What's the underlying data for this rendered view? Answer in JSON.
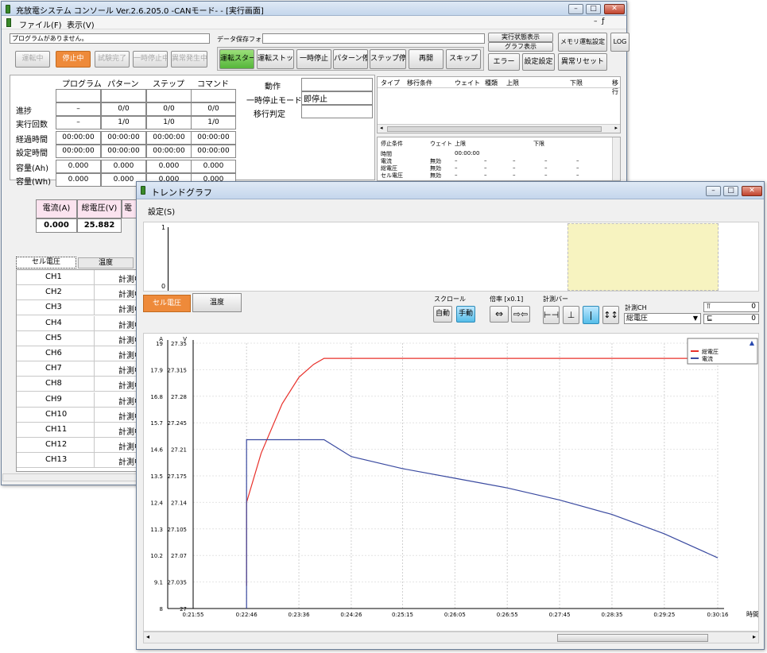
{
  "main_window": {
    "title": "充放電システム コンソール  Ver.2.6.205.0 -CANモード- - [実行画面]",
    "menu": {
      "file": "ファイル(F)",
      "view": "表示(V)"
    },
    "program_status": "プログラムがありません。",
    "data_folder_label": "データ保存フォルダ",
    "buttons_left": [
      "運転中",
      "停止中",
      "試験完了",
      "一時停止中",
      "異常発生中"
    ],
    "buttons_mid": [
      "運転スタート",
      "運転ストップ",
      "一時停止",
      "パターン停止",
      "ステップ停止",
      "再開",
      "スキップ"
    ],
    "buttons_right": {
      "exec_display": "実行状態表示",
      "graph_display": "グラフ表示",
      "error": "エラー",
      "set_config": "設定設定",
      "memory_setting": "メモリ運転設定",
      "abnormal_reset": "異常リセット",
      "log": "LOG"
    },
    "table": {
      "headers": [
        "プログラム",
        "パターン",
        "ステップ",
        "コマンド"
      ],
      "rows": [
        {
          "label": "",
          "values": [
            "",
            "",
            "",
            ""
          ]
        },
        {
          "label": "進捗",
          "values": [
            "–",
            "0/0",
            "0/0",
            "0/0"
          ]
        },
        {
          "label": "実行回数",
          "values": [
            "–",
            "1/0",
            "1/0",
            "1/0"
          ]
        },
        {
          "label": "経過時間",
          "values": [
            "00:00:00",
            "00:00:00",
            "00:00:00",
            "00:00:00"
          ]
        },
        {
          "label": "設定時間",
          "values": [
            "00:00:00",
            "00:00:00",
            "00:00:00",
            "00:00:00"
          ]
        },
        {
          "label": "容量(Ah)",
          "values": [
            "0.000",
            "0.000",
            "0.000",
            "0.000"
          ]
        },
        {
          "label": "容量(Wh)",
          "values": [
            "0.000",
            "0.000",
            "0.000",
            "0.000"
          ]
        }
      ]
    },
    "action": {
      "label": "動作",
      "value": "",
      "pause_mode_label": "一時停止モード",
      "pause_mode_value": "即停止",
      "transition_label": "移行判定",
      "transition_value": ""
    },
    "transition_headers": [
      "タイプ",
      "移行条件",
      "ウェイト",
      "種類",
      "上限",
      "下限",
      "移行"
    ],
    "stop_headers": [
      "停止条件",
      "ウェイト",
      "上限",
      "下限"
    ],
    "stop_rows": [
      {
        "name": "時間",
        "wait": "",
        "upper": "00:00:00",
        "lower": "",
        "e1": "",
        "e2": "",
        "e3": ""
      },
      {
        "name": "電流",
        "wait": "無効",
        "upper": "–",
        "lower": "–",
        "e1": "–",
        "e2": "–",
        "e3": "–"
      },
      {
        "name": "総電圧",
        "wait": "無効",
        "upper": "–",
        "lower": "–",
        "e1": "–",
        "e2": "–",
        "e3": "–"
      },
      {
        "name": "セル電圧",
        "wait": "無効",
        "upper": "–",
        "lower": "–",
        "e1": "–",
        "e2": "–",
        "e3": "–"
      }
    ],
    "readout": {
      "current_label": "電流(A)",
      "current_value": "0.000",
      "voltage_label": "総電圧(V)",
      "voltage_value": "25.882",
      "third_label": "電"
    },
    "ch_tabs": [
      "セル電圧",
      "温度"
    ],
    "channels": [
      "CH1",
      "CH2",
      "CH3",
      "CH4",
      "CH5",
      "CH6",
      "CH7",
      "CH8",
      "CH9",
      "CH10",
      "CH11",
      "CH12",
      "CH13"
    ],
    "ch_status": "計測中"
  },
  "trend_window": {
    "title": "トレンドグラフ",
    "menu_settings": "設定(S)",
    "upper_plot": {
      "y_top": "1",
      "y_bottom": "0"
    },
    "tabs": [
      "セル電圧",
      "温度"
    ],
    "scroll_label": "スクロール",
    "scroll_buttons": [
      "自動",
      "手動"
    ],
    "zoom_label": "倍率 [x0.1]",
    "zoom_icons": [
      "zoom-in-icon",
      "zoom-out-icon"
    ],
    "measure_bar_label": "計測バー",
    "measure_ch_label": "計測CH",
    "measure_ch_value": "総電圧",
    "bar_values": [
      "0",
      "0"
    ],
    "x_axis_label": "時間",
    "left_axis_unit": "A",
    "right_axis_unit": "V"
  },
  "chart_data": {
    "type": "line",
    "x": [
      "0:21:55",
      "0:22:46",
      "0:23:36",
      "0:24:26",
      "0:25:15",
      "0:26:05",
      "0:26:55",
      "0:27:45",
      "0:28:35",
      "0:29:25",
      "0:30:16"
    ],
    "x_ticks": [
      "0:21:55",
      "0:22:46",
      "0:23:36",
      "0:24:26",
      "0:25:15",
      "0:26:05",
      "0:26:55",
      "0:27:45",
      "0:28:35",
      "0:29:25",
      "0:30:16"
    ],
    "xlabel": "時間",
    "y_left_ticks": [
      "19",
      "17.9",
      "16.8",
      "15.7",
      "14.6",
      "13.5",
      "12.4",
      "11.3",
      "10.2",
      "9.1",
      "8"
    ],
    "y_right_ticks": [
      "27.35",
      "27.315",
      "27.28",
      "27.245",
      "27.21",
      "27.175",
      "27.14",
      "27.105",
      "27.07",
      "27.035",
      "27"
    ],
    "ylim_left": [
      8,
      19
    ],
    "ylim_right": [
      27,
      27.35
    ],
    "series": [
      {
        "name": "総電圧",
        "axis": "right",
        "color": "#e8302a",
        "x": [
          "0:22:46",
          "0:22:46",
          "0:23:00",
          "0:23:20",
          "0:23:36",
          "0:23:50",
          "0:24:00",
          "0:24:26",
          "0:25:15",
          "0:26:05",
          "0:26:55",
          "0:27:45",
          "0:28:35",
          "0:29:25",
          "0:30:16"
        ],
        "values": [
          27.03,
          27.14,
          27.205,
          27.27,
          27.305,
          27.322,
          27.33,
          27.33,
          27.33,
          27.33,
          27.33,
          27.33,
          27.33,
          27.33,
          27.33
        ]
      },
      {
        "name": "電流",
        "axis": "left",
        "color": "#3a4aa0",
        "x": [
          "0:22:46",
          "0:22:46",
          "0:23:36",
          "0:24:00",
          "0:24:26",
          "0:25:15",
          "0:26:05",
          "0:26:55",
          "0:27:45",
          "0:28:35",
          "0:29:25",
          "0:30:16"
        ],
        "values": [
          8.0,
          15.0,
          15.0,
          15.0,
          14.3,
          13.8,
          13.4,
          13.0,
          12.5,
          11.9,
          11.1,
          10.1
        ]
      }
    ],
    "legend": "top-right",
    "grid": true
  }
}
